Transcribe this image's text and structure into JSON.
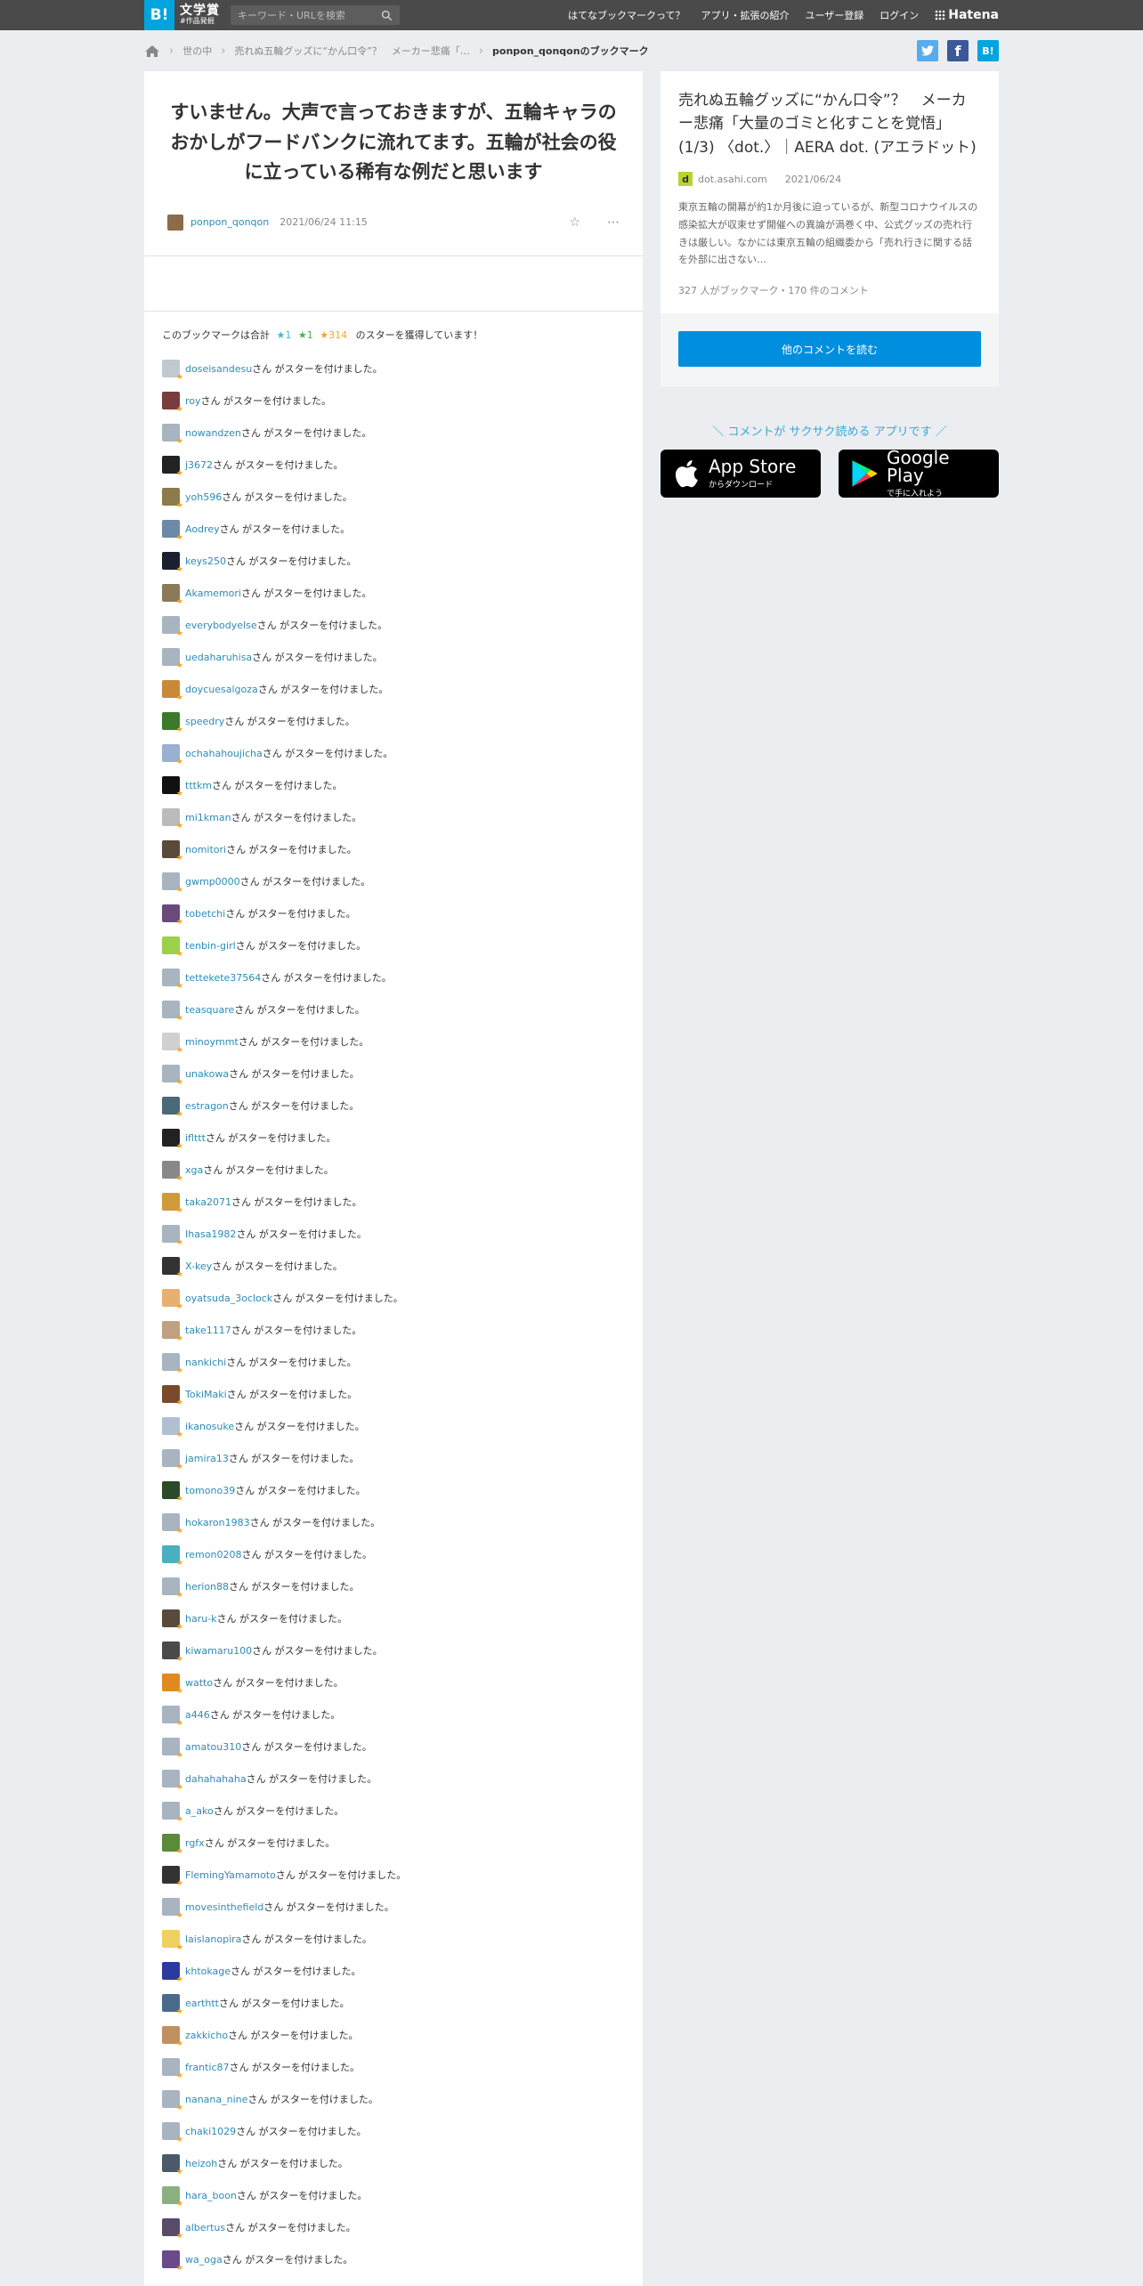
{
  "header": {
    "logo": "B!",
    "award_line1": "文学賞",
    "award_line2": "#作品発掘",
    "search_placeholder": "キーワード・URLを検索",
    "nav": [
      "はてなブックマークって？",
      "アプリ・拡張の紹介",
      "ユーザー登録",
      "ログイン"
    ],
    "hatena": "Hatena"
  },
  "breadcrumb": {
    "items": [
      "世の中",
      "売れぬ五輪グッズに“かん口令”？　メーカー悲痛「…",
      "ponpon_qonqonのブックマーク"
    ]
  },
  "share": {
    "twitter": "t",
    "facebook": "f",
    "hatebu": "B!"
  },
  "bookmark": {
    "comment": "すいません。大声で言っておきますが、五輪キャラのおかしがフードバンクに流れてます。五輪が社会の役に立っている稀有な例だと思います",
    "user": "ponpon_qonqon",
    "date": "2021/06/24 11:15",
    "star_summary_prefix": "このブックマークは合計",
    "star_blue": "1",
    "star_green": "1",
    "star_yellow": "314",
    "star_summary_suffix": "のスターを獲得しています！"
  },
  "star_suffix": "さん がスターを付けました。",
  "stars": [
    {
      "user": "doseisandesu",
      "color": "#c0c8d0"
    },
    {
      "user": "roy",
      "color": "#7a3d3d"
    },
    {
      "user": "nowandzen",
      "color": "#a8b4c0"
    },
    {
      "user": "j3672",
      "color": "#222"
    },
    {
      "user": "yoh596",
      "color": "#8b7b4a"
    },
    {
      "user": "Aodrey",
      "color": "#6a8aa8"
    },
    {
      "user": "keys250",
      "color": "#1a2030"
    },
    {
      "user": "Akamemori",
      "color": "#8a7a5a"
    },
    {
      "user": "everybodyelse",
      "color": "#a8b4c0"
    },
    {
      "user": "uedaharuhisa",
      "color": "#a8b4c0"
    },
    {
      "user": "doycuesalgoza",
      "color": "#c88a3a"
    },
    {
      "user": "speedry",
      "color": "#3a7a2a"
    },
    {
      "user": "ochahahoujicha",
      "color": "#9ab0d0"
    },
    {
      "user": "tttkm",
      "color": "#111"
    },
    {
      "user": "mi1kman",
      "color": "#bbb"
    },
    {
      "user": "nomitori",
      "color": "#5a4a3a"
    },
    {
      "user": "gwmp0000",
      "color": "#a8b4c0"
    },
    {
      "user": "tobetchi",
      "color": "#6a4a7a"
    },
    {
      "user": "tenbin-girl",
      "color": "#9ad04a"
    },
    {
      "user": "tettekete37564",
      "color": "#a8b4c0"
    },
    {
      "user": "teasquare",
      "color": "#a8b4c0"
    },
    {
      "user": "minoymmt",
      "color": "#d0d0d0"
    },
    {
      "user": "unakowa",
      "color": "#a8b4c0"
    },
    {
      "user": "estragon",
      "color": "#4a6a7a"
    },
    {
      "user": "iflttt",
      "color": "#222"
    },
    {
      "user": "xga",
      "color": "#888"
    },
    {
      "user": "taka2071",
      "color": "#d09a3a"
    },
    {
      "user": "Ihasa1982",
      "color": "#a8b4c0"
    },
    {
      "user": "X-key",
      "color": "#333"
    },
    {
      "user": "oyatsuda_3oclock",
      "color": "#e8b070"
    },
    {
      "user": "take1117",
      "color": "#c0a080"
    },
    {
      "user": "nankichi",
      "color": "#a8b4c0"
    },
    {
      "user": "TokiMaki",
      "color": "#7a4a2a"
    },
    {
      "user": "ikanosuke",
      "color": "#b0c0d0"
    },
    {
      "user": "jamira13",
      "color": "#a8b4c0"
    },
    {
      "user": "tomono39",
      "color": "#2a4a2a"
    },
    {
      "user": "hokaron1983",
      "color": "#a8b4c0"
    },
    {
      "user": "remon0208",
      "color": "#4ab0c0"
    },
    {
      "user": "herion88",
      "color": "#a8b4c0"
    },
    {
      "user": "haru-k",
      "color": "#5a4a3a"
    },
    {
      "user": "kiwamaru100",
      "color": "#4a4a4a"
    },
    {
      "user": "watto",
      "color": "#e08a20"
    },
    {
      "user": "a446",
      "color": "#a8b4c0"
    },
    {
      "user": "amatou310",
      "color": "#a8b4c0"
    },
    {
      "user": "dahahahaha",
      "color": "#a8b4c0"
    },
    {
      "user": "a_ako",
      "color": "#a8b4c0"
    },
    {
      "user": "rgfx",
      "color": "#5a8a3a"
    },
    {
      "user": "FlemingYamamoto",
      "color": "#333"
    },
    {
      "user": "movesinthefield",
      "color": "#a8b4c0"
    },
    {
      "user": "laislanopira",
      "color": "#f0d060"
    },
    {
      "user": "khtokage",
      "color": "#2a3aa0"
    },
    {
      "user": "earthtt",
      "color": "#4a6a8a"
    },
    {
      "user": "zakkicho",
      "color": "#c09060"
    },
    {
      "user": "frantic87",
      "color": "#a8b4c0"
    },
    {
      "user": "nanana_nine",
      "color": "#a8b4c0"
    },
    {
      "user": "chaki1029",
      "color": "#a8b4c0"
    },
    {
      "user": "heizoh",
      "color": "#4a5a6a"
    },
    {
      "user": "hara_boon",
      "color": "#8ab080"
    },
    {
      "user": "albertus",
      "color": "#5a4a6a"
    },
    {
      "user": "wa_oga",
      "color": "#6a4a8a"
    }
  ],
  "entry": {
    "title": "売れぬ五輪グッズに“かん口令”？　メーカー悲痛「大量のゴミと化すことを覚悟」(1/3) 〈dot.〉｜AERA dot. (アエラドット)",
    "favicon": "d",
    "domain": "dot.asahi.com",
    "date": "2021/06/24",
    "description": "東京五輪の開幕が約1か月後に迫っているが、新型コロナウイルスの感染拡大が収束せず開催への異論が渦巻く中、公式グッズの売れ行きは厳しい。なかには東京五輪の組織委から「売れ行きに関する話を外部に出さない…",
    "counts": "327 人がブックマーク・170 件のコメント",
    "more_button": "他のコメントを読む"
  },
  "app_promo": {
    "lead": "＼ コメントが サクサク読める アプリです ／",
    "appstore_big": "App Store",
    "appstore_small": "からダウンロード",
    "googleplay_big": "Google Play",
    "googleplay_small": "で手に入れよう"
  },
  "colors": {
    "accent": "#00a4de",
    "link": "#2d8bb5",
    "star_yellow": "#f5a623"
  }
}
